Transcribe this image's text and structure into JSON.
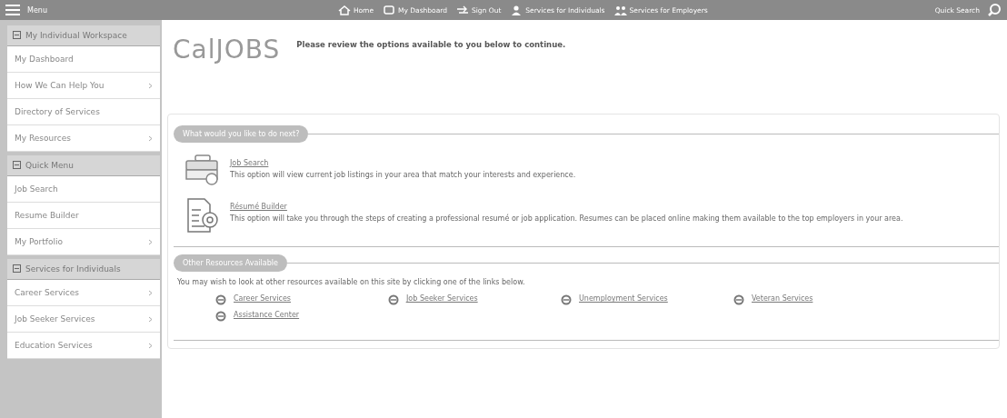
{
  "top_bar": {
    "menu_label": "Menu",
    "nav": [
      {
        "label": "Home"
      },
      {
        "label": "My Dashboard"
      },
      {
        "label": "Sign Out"
      },
      {
        "label": "Services for Individuals"
      },
      {
        "label": "Services for Employers"
      }
    ],
    "quick_search": "Quick Search"
  },
  "sidebar": [
    {
      "title": "My Individual Workspace",
      "expanded": true,
      "items": [
        {
          "label": "My Dashboard",
          "submenu": false
        },
        {
          "label": "How We Can Help You",
          "submenu": true
        },
        {
          "label": "Directory of Services",
          "submenu": false
        },
        {
          "label": "My Resources",
          "submenu": true
        }
      ]
    },
    {
      "title": "Quick Menu",
      "expanded": true,
      "items": [
        {
          "label": "Job Search",
          "submenu": false
        },
        {
          "label": "Resume Builder",
          "submenu": false
        },
        {
          "label": "My Portfolio",
          "submenu": true
        }
      ]
    },
    {
      "title": "Services for Individuals",
      "expanded": true,
      "items": [
        {
          "label": "Career Services",
          "submenu": true
        },
        {
          "label": "Job Seeker Services",
          "submenu": true
        },
        {
          "label": "Education Services",
          "submenu": true
        }
      ]
    }
  ],
  "logo": "CalJOBS",
  "intro": "Please review the options available to you below to continue.",
  "next_section": {
    "title": "What would you like to do next?",
    "options": [
      {
        "link": "Job Search",
        "description": "This option will view current job listings in your area that match your interests and experience."
      },
      {
        "link": "Résumé Builder",
        "description": "This option will take you through the steps of creating a professional resumé or job application. Resumes can be placed online making them available to the top employers in your area."
      }
    ]
  },
  "resources_section": {
    "title": "Other Resources Available",
    "text": "You may wish to look at other resources available on this site by clicking one of the links below.",
    "links": [
      "Career Services",
      "Job Seeker Services",
      "Unemployment Services",
      "Veteran Services",
      "Assistance Center"
    ]
  }
}
